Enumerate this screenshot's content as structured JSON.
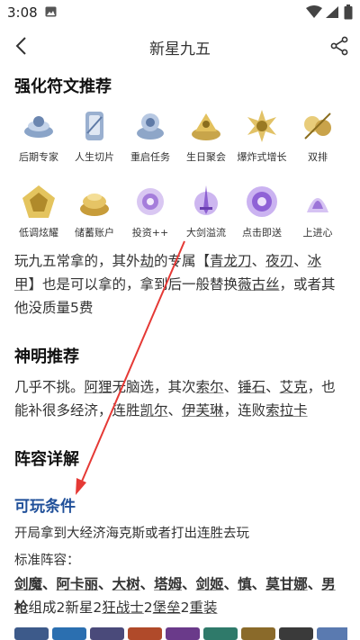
{
  "status": {
    "time": "3:08"
  },
  "app_bar": {
    "title": "新星九五"
  },
  "sections": {
    "runes_title": "强化符文推荐",
    "gods_title": "神明推荐",
    "lineup_title": "阵容详解"
  },
  "runes": [
    {
      "label": "后期专家",
      "icon": "late-game-icon"
    },
    {
      "label": "人生切片",
      "icon": "life-slice-icon"
    },
    {
      "label": "重启任务",
      "icon": "restart-task-icon"
    },
    {
      "label": "生日聚会",
      "icon": "birthday-party-icon"
    },
    {
      "label": "爆炸式增长",
      "icon": "explosive-growth-icon"
    },
    {
      "label": "双排",
      "icon": "duo-queue-icon"
    },
    {
      "label": "低调炫耀",
      "icon": "low-key-show-icon"
    },
    {
      "label": "储蓄账户",
      "icon": "savings-account-icon"
    },
    {
      "label": "投资++",
      "icon": "investment-icon"
    },
    {
      "label": "大剑溢流",
      "icon": "big-sword-icon"
    },
    {
      "label": "点击即送",
      "icon": "click-send-icon"
    },
    {
      "label": "上进心",
      "icon": "ambition-icon"
    }
  ],
  "rune_para": {
    "t1": "玩九五常拿的，其外",
    "k1": "劫",
    "t2": "的专属【",
    "k2": "青龙刀",
    "t3": "、",
    "k3": "夜刃",
    "t4": "、",
    "k4": "冰甲",
    "t5": "】也是可以拿的，拿到后一般替换",
    "k5": "薇古丝",
    "t6": "，或者其他没质量5费"
  },
  "gods_para": {
    "t1": "几乎不挑。",
    "k1": "阿狸",
    "t2": "无脑选，其次",
    "k2": "索尔",
    "t3": "、",
    "k3": "锤石",
    "t4": "、",
    "k4": "艾克",
    "t5": "，也能补很多经济，连胜",
    "k5": "凯尔",
    "t6": "、",
    "k6": "伊芙琳",
    "t7": "，连败",
    "k7": "索拉卡"
  },
  "conditions": {
    "title": "可玩条件",
    "text": "开局拿到大经济海克斯或者打出连胜去玩",
    "standard_label": "标准阵容："
  },
  "lineup_para": {
    "k1": "剑魔",
    "t1": "、",
    "k2": "阿卡丽",
    "t2": "、",
    "k3": "大树",
    "t3": "、",
    "k4": "塔姆",
    "t4": "、",
    "k5": "剑姬",
    "t5": "、",
    "k6": "慎",
    "t6": "、",
    "k7": "莫甘娜",
    "t7": "、",
    "k8": "男枪",
    "t8": "组成2新星2",
    "k9": "狂战士",
    "t9": "2",
    "k10": "堡垒",
    "t10": "2",
    "k11": "重装"
  },
  "colors": {
    "subtitle": "#1f4f99",
    "annotation_arrow": "#e53935"
  }
}
